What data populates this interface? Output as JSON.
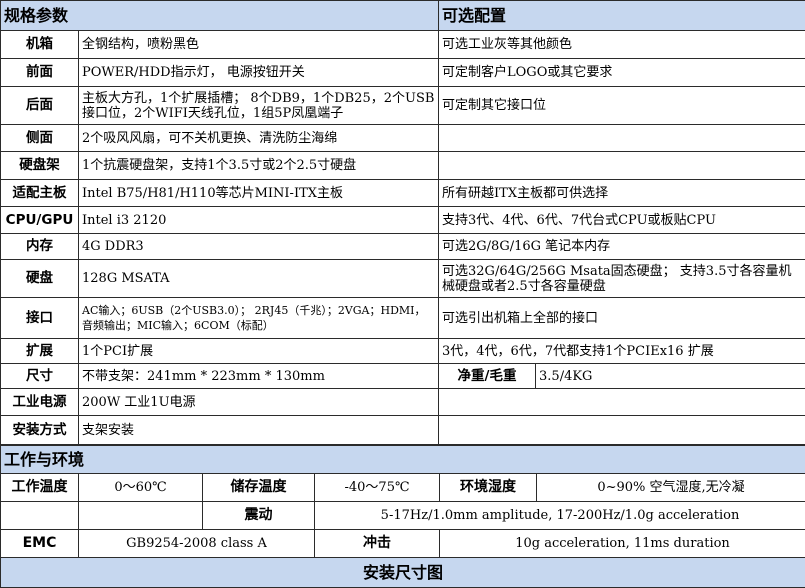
{
  "spec": {
    "header_left": "规格参数",
    "header_right": "可选配置",
    "rows": [
      {
        "label": "机箱",
        "value": "全钢结构，喷粉黑色",
        "option": "可选工业灰等其他颜色"
      },
      {
        "label": "前面",
        "value": "POWER/HDD指示灯， 电源按钮开关",
        "option": "可定制客户LOGO或其它要求"
      },
      {
        "label": "后面",
        "value": "主板大方孔，1个扩展插槽； 8个DB9，1个DB25，2个USB接口位，2个WIFI天线孔位，1组5P凤凰端子",
        "option": "可定制其它接口位"
      },
      {
        "label": "侧面",
        "value": "2个吸风风扇，可不关机更换、清洗防尘海绵",
        "option": ""
      },
      {
        "label": "硬盘架",
        "value": "1个抗震硬盘架，支持1个3.5寸或2个2.5寸硬盘",
        "option": ""
      },
      {
        "label": "适配主板",
        "value": "Intel B75/H81/H110等芯片MINI-ITX主板",
        "option": "所有研越ITX主板都可供选择"
      },
      {
        "label": "CPU/GPU",
        "value": "Intel i3 2120",
        "option": "支持3代、4代、6代、7代台式CPU或板贴CPU"
      },
      {
        "label": "内存",
        "value": "4G DDR3",
        "option": "可选2G/8G/16G 笔记本内存"
      },
      {
        "label": "硬盘",
        "value": "128G MSATA",
        "option": "可选32G/64G/256G Msata固态硬盘； 支持3.5寸各容量机械硬盘或者2.5寸各容量硬盘"
      },
      {
        "label": "接口",
        "value": "AC输入；6USB（2个USB3.0）； 2RJ45（千兆）；2VGA；HDMI，音频输出；MIC输入；6COM（标配）",
        "option": "可选引出机箱上全部的接口"
      },
      {
        "label": "扩展",
        "value": "1个PCI扩展",
        "option": "3代，4代，6代，7代都支持1个PCIEx16 扩展"
      }
    ],
    "size": {
      "label": "尺寸",
      "value": "不带支架：241mm  * 223mm * 130mm",
      "weight_label": "净重/毛重",
      "weight_value": "3.5/4KG"
    },
    "power": {
      "label": "工业电源",
      "value": "200W 工业1U电源"
    },
    "install": {
      "label": "安装方式",
      "value": "支架安装"
    }
  },
  "env": {
    "header": "工作与环境",
    "work_temp_label": "工作温度",
    "work_temp_value": "0～60℃",
    "store_temp_label": "储存温度",
    "store_temp_value": "-40～75℃",
    "humidity_label": "环境湿度",
    "humidity_value": "0~90% 空气湿度,无冷凝",
    "vibration_label": "震动",
    "vibration_value": "5-17Hz/1.0mm amplitude, 17-200Hz/1.0g acceleration",
    "emc_label": "EMC",
    "emc_value": "GB9254-2008 class A",
    "shock_label": "冲击",
    "shock_value": "10g acceleration, 11ms duration"
  },
  "footer_title": "安装尺寸图"
}
